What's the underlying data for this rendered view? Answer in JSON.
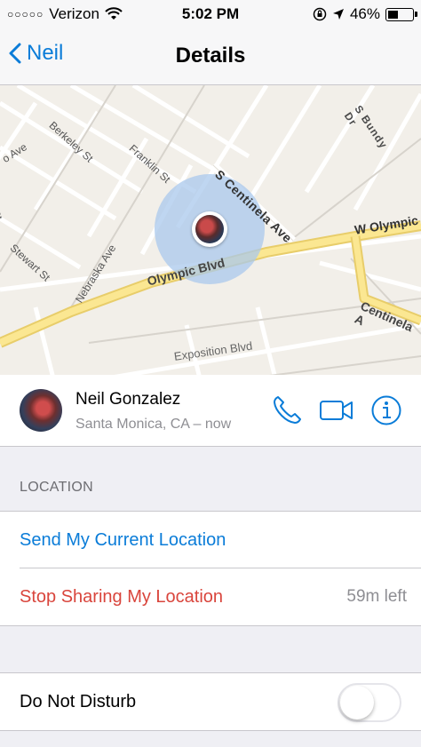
{
  "status_bar": {
    "carrier": "Verizon",
    "time": "5:02 PM",
    "battery": "46%",
    "battery_level": 0.46
  },
  "nav": {
    "back_label": "Neil",
    "title": "Details"
  },
  "map": {
    "streets": [
      "S Bundy Dr",
      "Berkeley St",
      "Franklin St",
      "S Centinela Ave",
      "W Olympic",
      "Stewart St",
      "Nebraska Ave",
      "Olympic Blvd",
      "Centinela A",
      "Exposition Blvd",
      "o Ave",
      "St"
    ]
  },
  "contact": {
    "name": "Neil Gonzalez",
    "subtitle": "Santa Monica, CA – now"
  },
  "location": {
    "header": "LOCATION",
    "send_label": "Send My Current Location",
    "stop_label": "Stop Sharing My Location",
    "stop_detail": "59m left"
  },
  "dnd": {
    "label": "Do Not Disturb",
    "enabled": false
  },
  "colors": {
    "accent": "#0a7cd8",
    "destructive": "#d9453c"
  }
}
